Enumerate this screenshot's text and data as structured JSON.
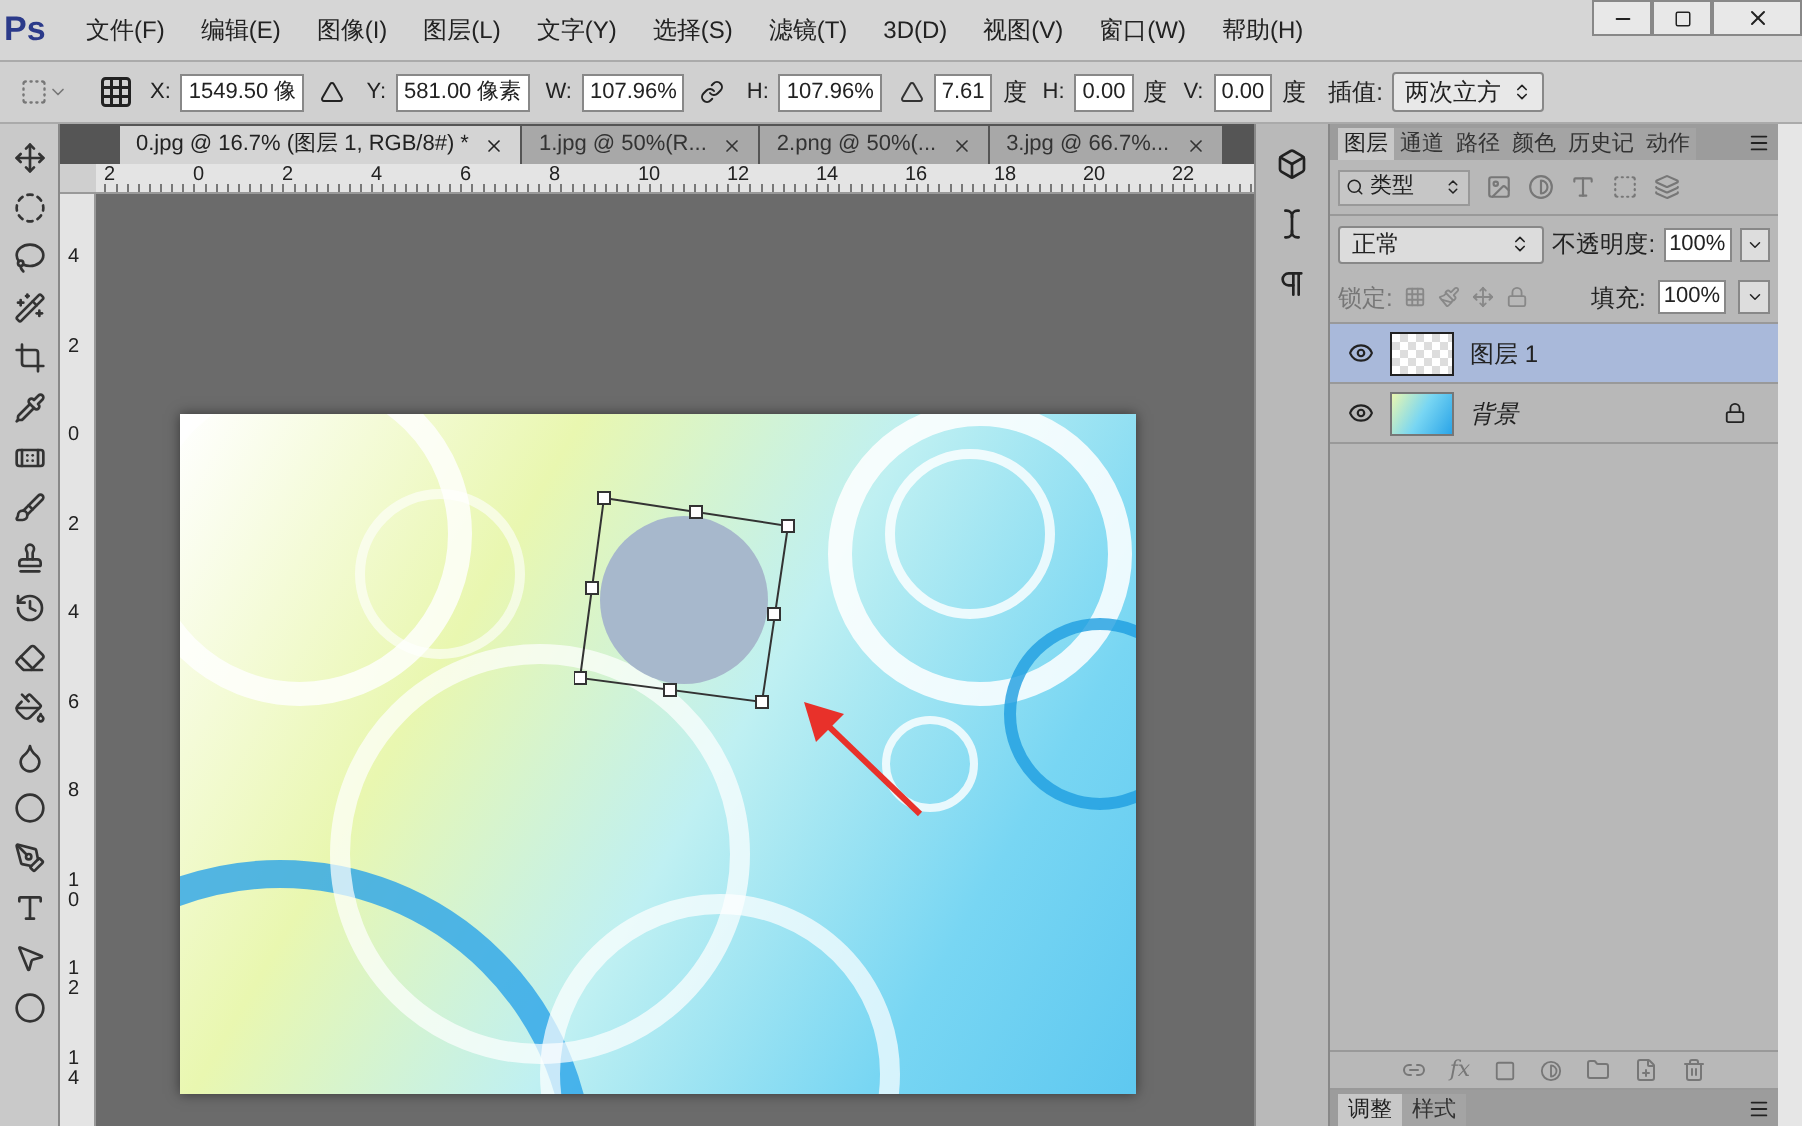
{
  "app": {
    "logo": "Ps"
  },
  "menu": [
    "文件(F)",
    "编辑(E)",
    "图像(I)",
    "图层(L)",
    "文字(Y)",
    "选择(S)",
    "滤镜(T)",
    "3D(D)",
    "视图(V)",
    "窗口(W)",
    "帮助(H)"
  ],
  "options_bar": {
    "fields": [
      {
        "label": "X:",
        "value": "1549.50 像"
      },
      {
        "label": "Y:",
        "value": "581.00 像素"
      },
      {
        "label": "W:",
        "value": "107.96%"
      },
      {
        "label": "H:",
        "value": "107.96%"
      },
      {
        "value": "7.61",
        "unit": "度"
      },
      {
        "label": "H:",
        "value": "0.00",
        "unit": "度"
      },
      {
        "label": "V:",
        "value": "0.00",
        "unit": "度"
      }
    ],
    "interpolation_label": "插值:",
    "interpolation": "两次立方"
  },
  "doc_tabs": [
    {
      "title": "0.jpg @ 16.7% (图层 1, RGB/8#) *",
      "selected": true
    },
    {
      "title": "1.jpg @ 50%(R...",
      "selected": false
    },
    {
      "title": "2.png @ 50%(...",
      "selected": false
    },
    {
      "title": "3.jpg @ 66.7%...",
      "selected": false
    }
  ],
  "ruler": {
    "horizontal": [
      "2",
      "0",
      "2",
      "4",
      "6",
      "8",
      "10",
      "12",
      "14",
      "16",
      "18",
      "20",
      "22"
    ],
    "vertical": [
      "4",
      "2",
      "0",
      "2",
      "4",
      "6",
      "8",
      "10",
      "12",
      "14"
    ]
  },
  "layers_panel": {
    "tabs": [
      {
        "label": "图层",
        "selected": true
      },
      {
        "label": "通道",
        "selected": false
      },
      {
        "label": "路径",
        "selected": false
      },
      {
        "label": "颜色",
        "selected": false
      },
      {
        "label": "历史记",
        "selected": false
      },
      {
        "label": "动作",
        "selected": false
      }
    ],
    "filter": "类型",
    "blend_mode": "正常",
    "opacity_label": "不透明度:",
    "opacity": "100%",
    "lock_label": "锁定:",
    "fill_label": "填充:",
    "fill": "100%",
    "layers": [
      {
        "name": "图层 1",
        "selected": true,
        "visible": true,
        "locked": false,
        "italic": false,
        "kind": "transparent"
      },
      {
        "name": "背景",
        "selected": false,
        "visible": true,
        "locked": true,
        "italic": true,
        "kind": "image"
      }
    ]
  },
  "layer_style_button": "fx",
  "bottom_tabs": [
    {
      "label": "调整",
      "selected": true
    },
    {
      "label": "样式",
      "selected": false
    }
  ]
}
